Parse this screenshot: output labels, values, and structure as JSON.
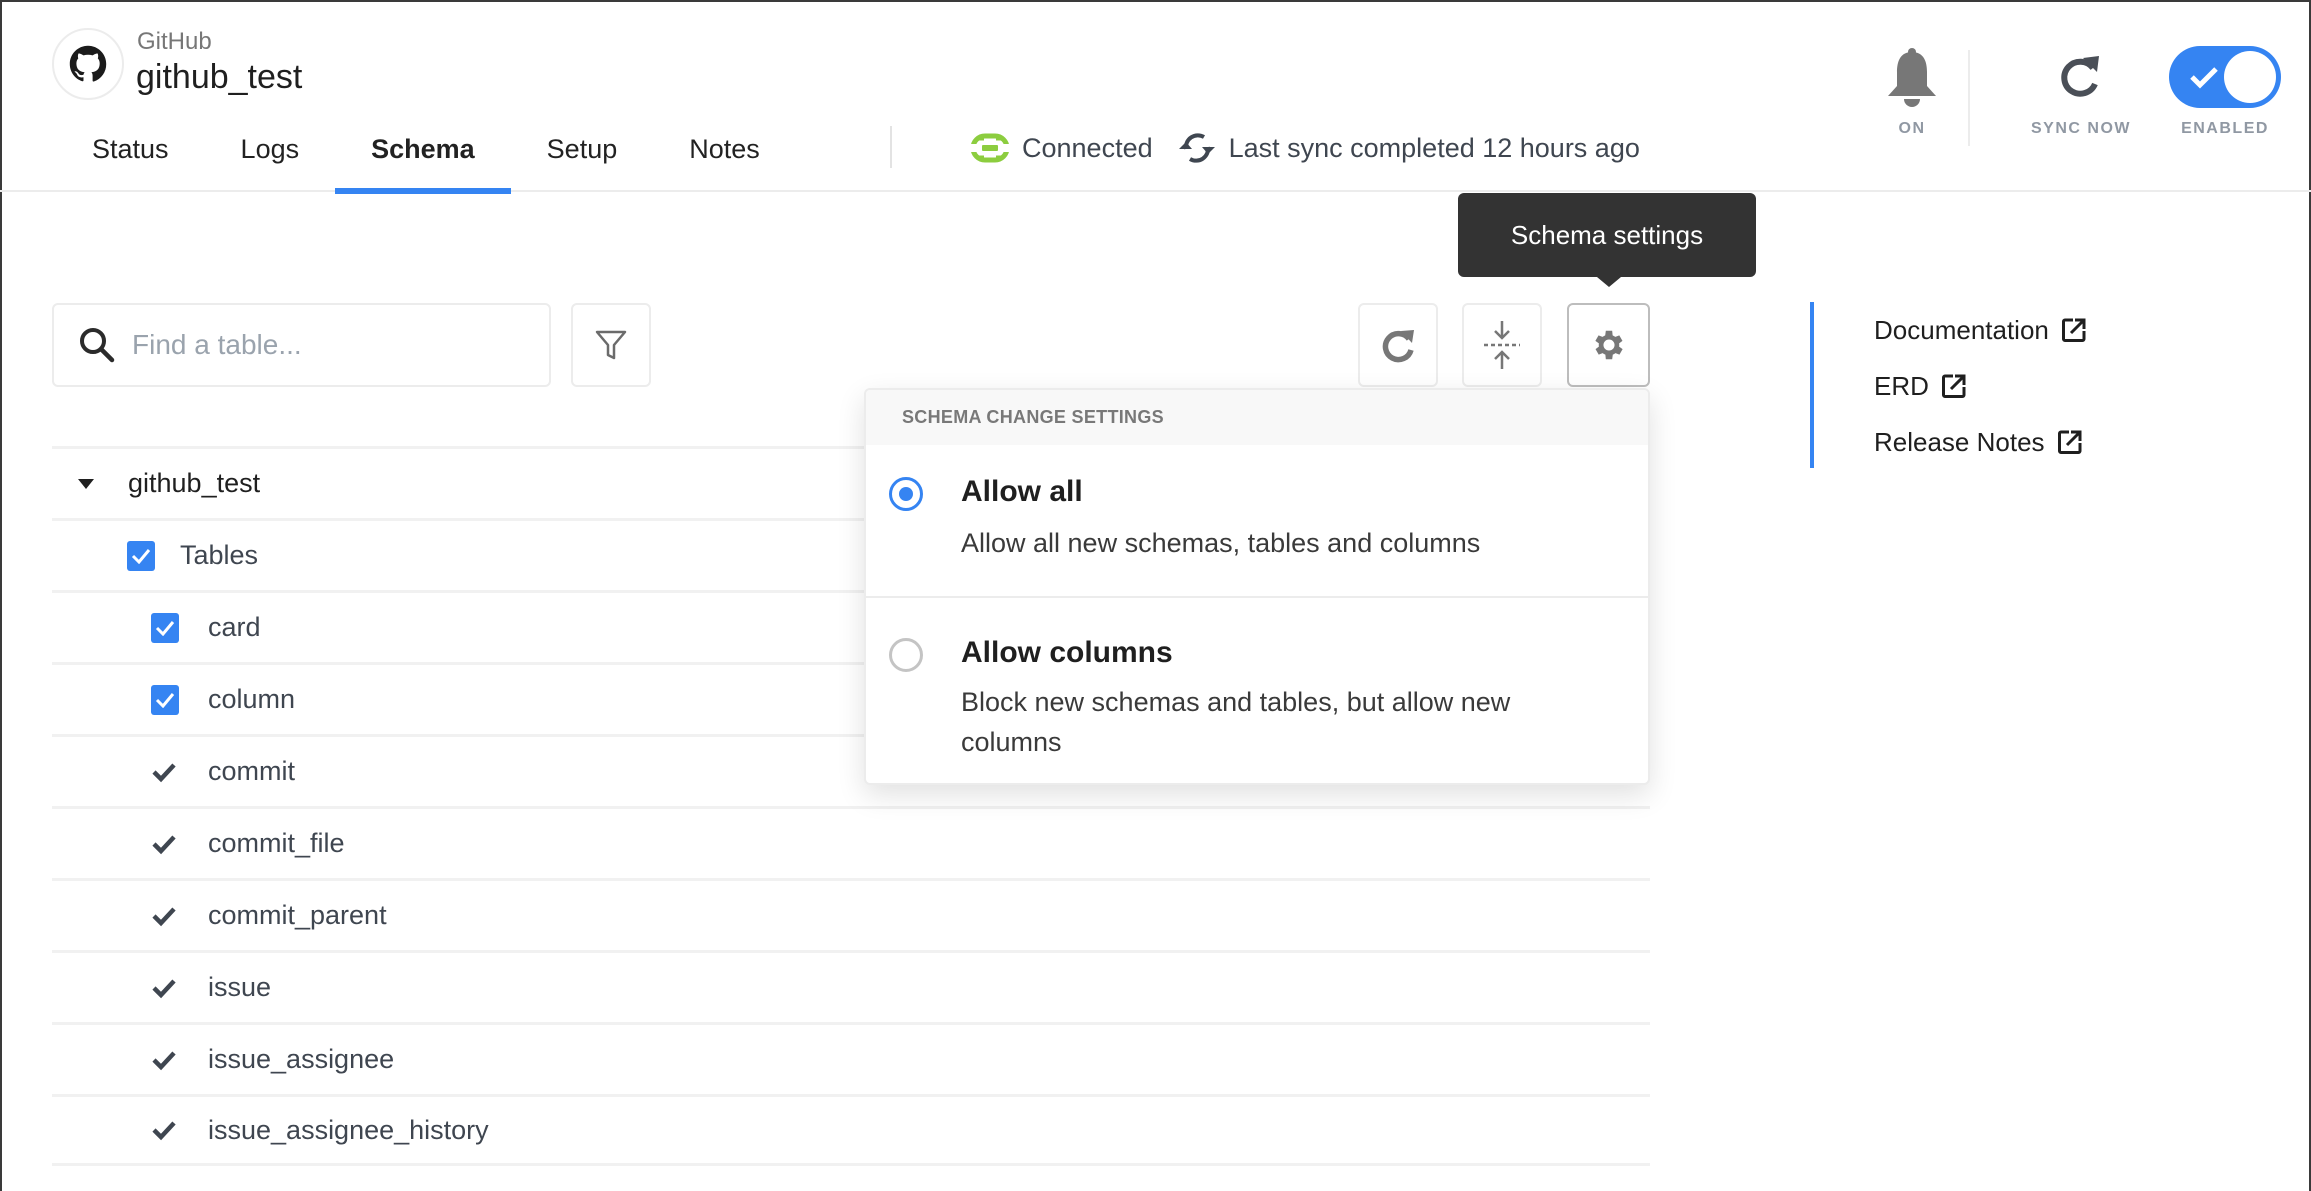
{
  "header": {
    "connector_type": "GitHub",
    "connector_name": "github_test",
    "logo_icon": "github-icon",
    "tabs": [
      {
        "label": "Status",
        "active": false
      },
      {
        "label": "Logs",
        "active": false
      },
      {
        "label": "Schema",
        "active": true
      },
      {
        "label": "Setup",
        "active": false
      },
      {
        "label": "Notes",
        "active": false
      }
    ],
    "status": {
      "connection_label": "Connected",
      "connection_icon": "link-icon",
      "sync_label": "Last sync completed 12 hours ago",
      "sync_icon": "sync-icon"
    },
    "actions": {
      "notifications_label": "ON",
      "sync_now_label": "SYNC NOW",
      "enabled_label": "ENABLED",
      "enabled": true
    }
  },
  "tooltip": {
    "text": "Schema settings"
  },
  "toolbar": {
    "search_placeholder": "Find a table...",
    "search_value": "",
    "buttons": [
      "filter-icon",
      "refresh-icon",
      "collapse-icon",
      "gear-icon"
    ]
  },
  "tree": {
    "root": {
      "label": "github_test",
      "expanded": true
    },
    "group": {
      "label": "Tables",
      "checked": true
    },
    "tables": [
      {
        "name": "card",
        "type": "checkbox",
        "checked": true
      },
      {
        "name": "column",
        "type": "checkbox",
        "checked": true
      },
      {
        "name": "commit",
        "type": "check",
        "checked": true
      },
      {
        "name": "commit_file",
        "type": "check",
        "checked": true
      },
      {
        "name": "commit_parent",
        "type": "check",
        "checked": true
      },
      {
        "name": "issue",
        "type": "check",
        "checked": true
      },
      {
        "name": "issue_assignee",
        "type": "check",
        "checked": true
      },
      {
        "name": "issue_assignee_history",
        "type": "check",
        "checked": true
      }
    ]
  },
  "schema_settings": {
    "heading": "SCHEMA CHANGE SETTINGS",
    "options": [
      {
        "title": "Allow all",
        "description": "Allow all new schemas, tables and columns",
        "selected": true
      },
      {
        "title": "Allow columns",
        "description": "Block new schemas and tables, but allow new columns",
        "selected": false
      }
    ]
  },
  "links": [
    {
      "label": "Documentation"
    },
    {
      "label": "ERD"
    },
    {
      "label": "Release Notes"
    }
  ],
  "colors": {
    "accent": "#3584f2",
    "connected": "#8ccd3f",
    "tooltip_bg": "#333333"
  }
}
